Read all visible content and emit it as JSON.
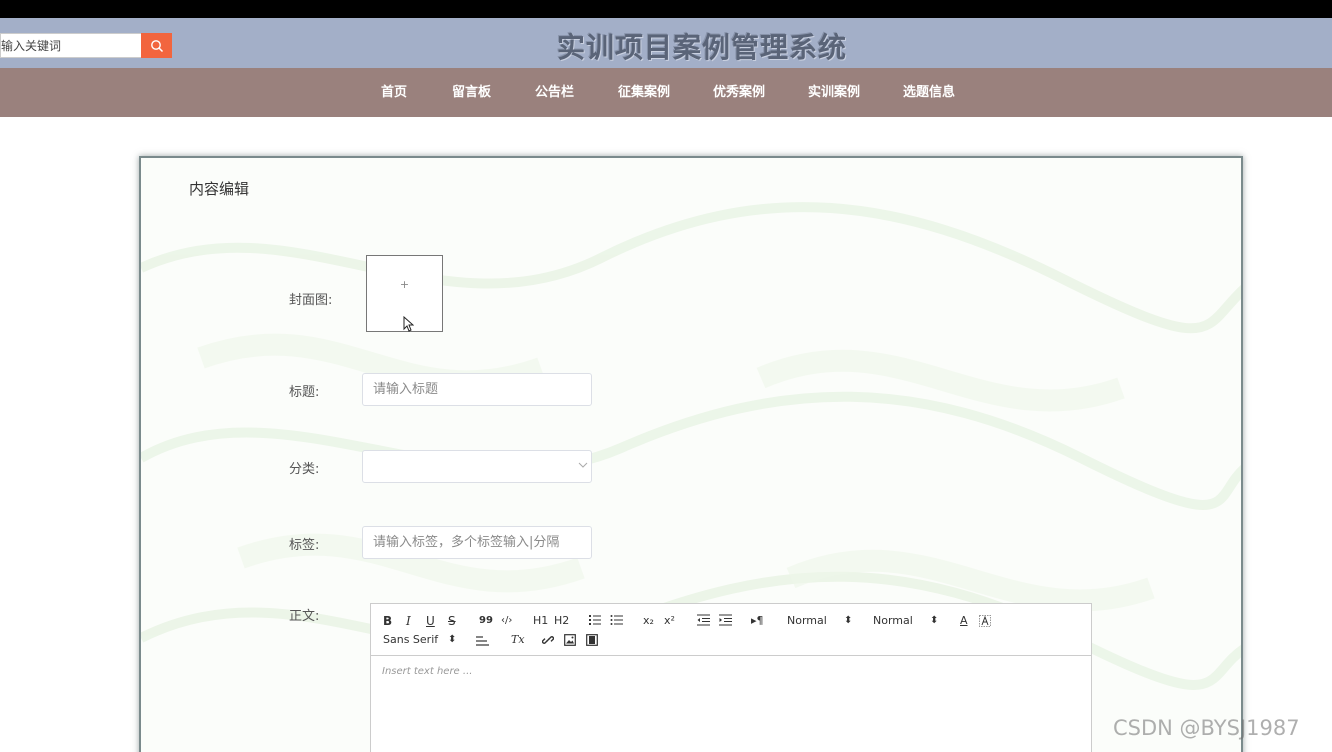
{
  "header": {
    "title": "实训项目案例管理系统",
    "search_placeholder": "输入关键词"
  },
  "nav": [
    "首页",
    "留言板",
    "公告栏",
    "征集案例",
    "优秀案例",
    "实训案例",
    "选题信息"
  ],
  "form": {
    "title": "内容编辑",
    "cover_label": "封面图:",
    "upload_plus": "+",
    "title_label": "标题:",
    "title_placeholder": "请输入标题",
    "category_label": "分类:",
    "category_value": "",
    "tags_label": "标签:",
    "tags_placeholder": "请输入标签，多个标签输入|分隔",
    "body_label": "正文:"
  },
  "editor": {
    "bold": "B",
    "italic": "I",
    "underline": "U",
    "strike": "S",
    "quote": "99",
    "code": "‹/›",
    "h1": "H1",
    "h2": "H2",
    "subscript": "x₂",
    "superscript": "x²",
    "direction": "▸¶",
    "size_value": "Normal",
    "header_value": "Normal",
    "font_color": "A",
    "font_family_value": "Sans Serif",
    "clean": "Tx",
    "placeholder": "Insert text here ..."
  },
  "watermark": "CSDN @BYSJ1987"
}
